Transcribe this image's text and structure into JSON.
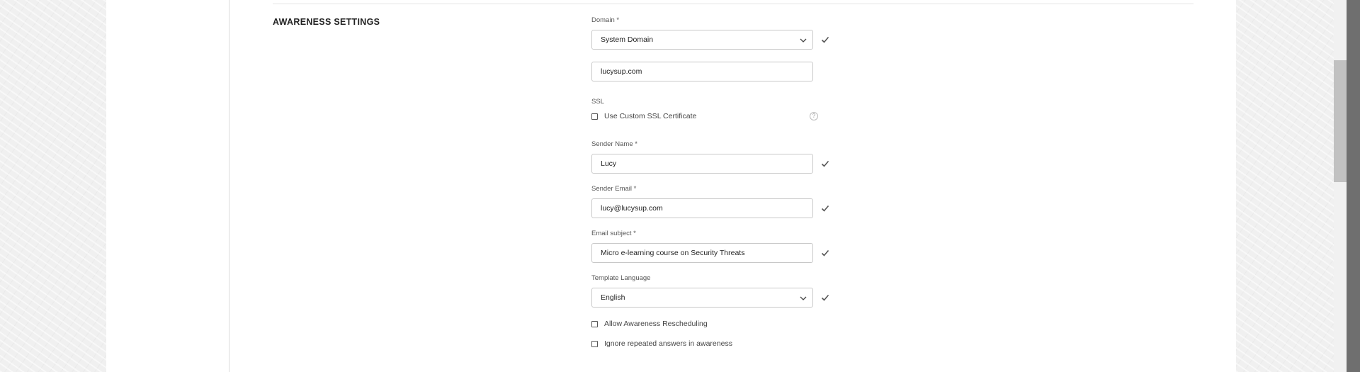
{
  "section": {
    "title": "AWARENESS SETTINGS"
  },
  "domain": {
    "label": "Domain *",
    "selected": "System Domain",
    "custom_value": "lucysup.com"
  },
  "ssl": {
    "label": "SSL",
    "checkbox_label": "Use Custom SSL Certificate",
    "checked": false,
    "help_icon": "?"
  },
  "sender_name": {
    "label": "Sender Name *",
    "value": "Lucy"
  },
  "sender_email": {
    "label": "Sender Email *",
    "value": "lucy@lucysup.com"
  },
  "email_subject": {
    "label": "Email subject *",
    "value": "Micro e-learning course on Security Threats"
  },
  "template_language": {
    "label": "Template Language",
    "selected": "English"
  },
  "options": {
    "allow_rescheduling": {
      "label": "Allow Awareness Rescheduling",
      "checked": false
    },
    "ignore_repeated": {
      "label": "Ignore repeated answers in awareness",
      "checked": false
    }
  },
  "icons": {
    "valid": "check-icon",
    "dropdown": "chevron-down-icon",
    "help": "help-circle-icon"
  }
}
